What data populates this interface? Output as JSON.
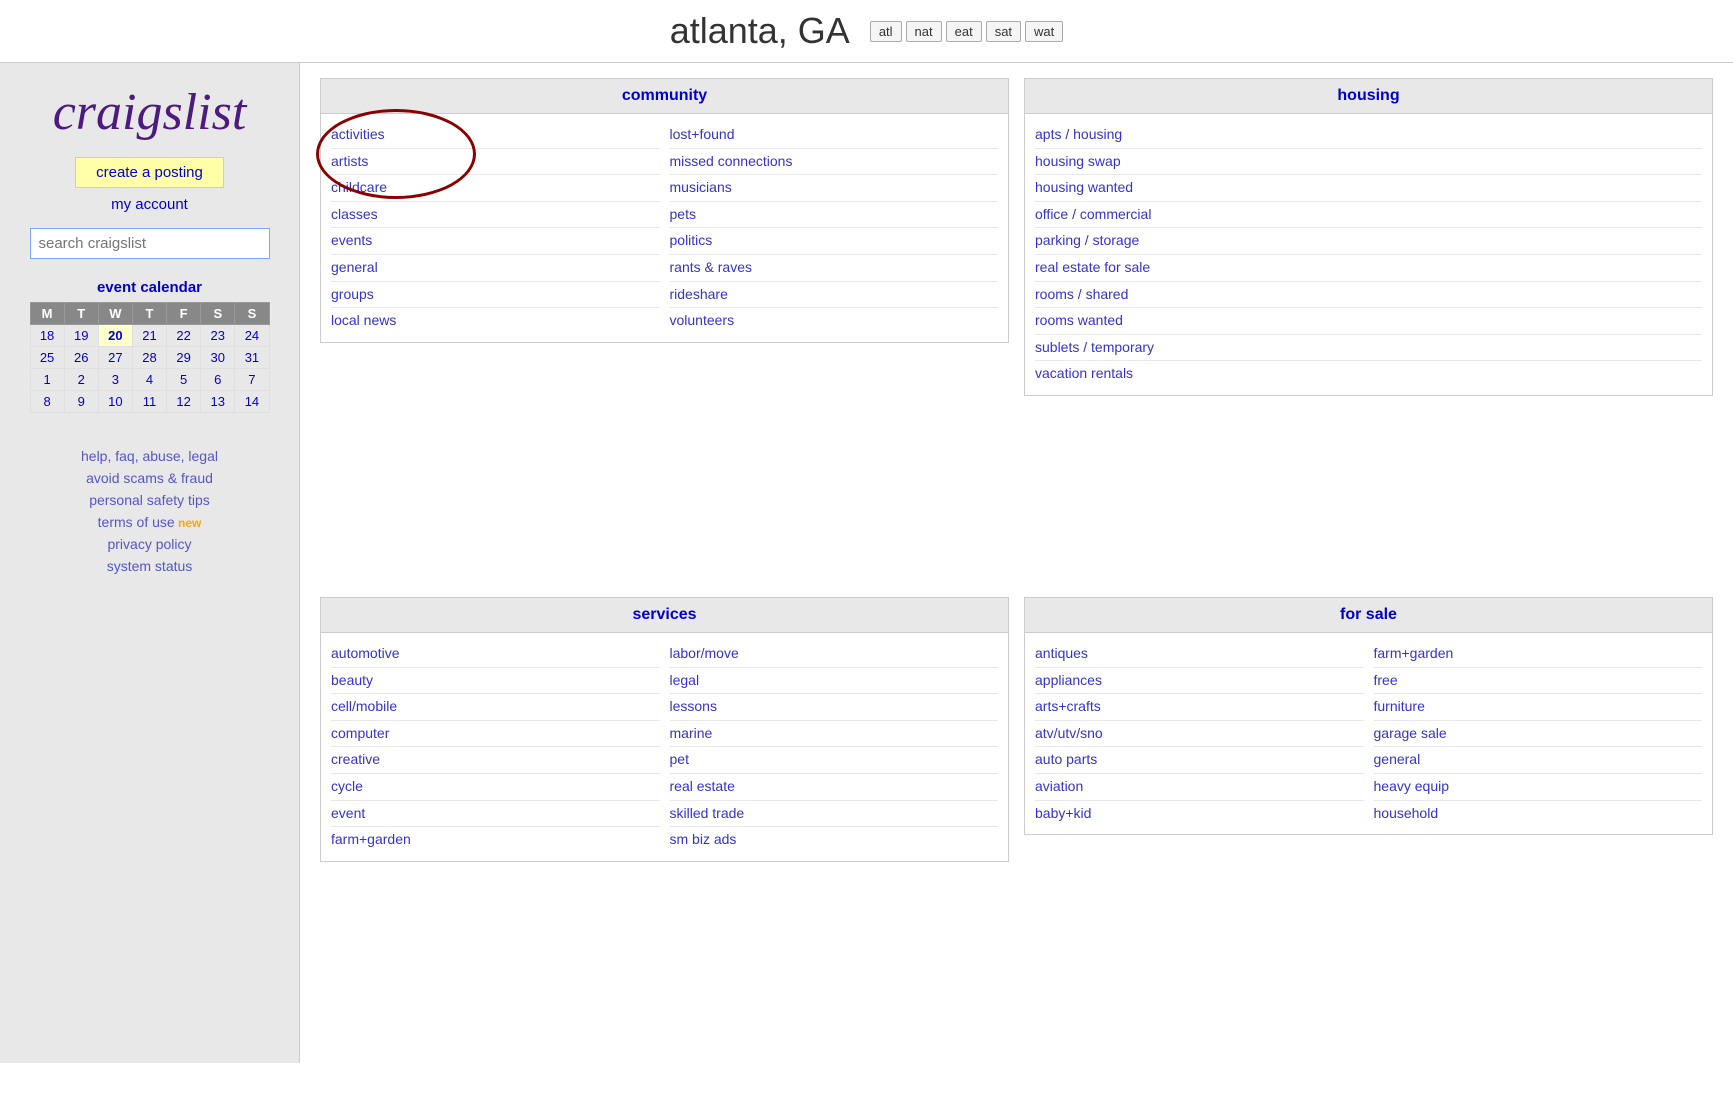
{
  "header": {
    "city": "atlanta, GA",
    "tabs": [
      "atl",
      "nat",
      "eat",
      "sat",
      "wat"
    ]
  },
  "sidebar": {
    "logo": "craigslist",
    "create_posting": "create a posting",
    "my_account": "my account",
    "search_placeholder": "search craigslist",
    "calendar_title": "event calendar",
    "calendar": {
      "days_header": [
        "M",
        "T",
        "W",
        "T",
        "F",
        "S",
        "S"
      ],
      "rows": [
        [
          "18",
          "19",
          "20",
          "21",
          "22",
          "23",
          "24"
        ],
        [
          "25",
          "26",
          "27",
          "28",
          "29",
          "30",
          "31"
        ],
        [
          "1",
          "2",
          "3",
          "4",
          "5",
          "6",
          "7"
        ],
        [
          "8",
          "9",
          "10",
          "11",
          "12",
          "13",
          "14"
        ]
      ],
      "today": "20"
    },
    "links": [
      {
        "label": "help, faq, abuse, legal",
        "new": false
      },
      {
        "label": "avoid scams & fraud",
        "new": false
      },
      {
        "label": "personal safety tips",
        "new": false
      },
      {
        "label": "terms of use",
        "new": true
      },
      {
        "label": "privacy policy",
        "new": false
      },
      {
        "label": "system status",
        "new": false
      }
    ]
  },
  "community": {
    "header": "community",
    "col1": [
      "activities",
      "artists",
      "childcare",
      "classes",
      "events",
      "general",
      "groups",
      "local news"
    ],
    "col2": [
      "lost+found",
      "missed connections",
      "musicians",
      "pets",
      "politics",
      "rants & raves",
      "rideshare",
      "volunteers"
    ]
  },
  "services": {
    "header": "services",
    "col1": [
      "automotive",
      "beauty",
      "cell/mobile",
      "computer",
      "creative",
      "cycle",
      "event",
      "farm+garden"
    ],
    "col2": [
      "labor/move",
      "legal",
      "lessons",
      "marine",
      "pet",
      "real estate",
      "skilled trade",
      "sm biz ads"
    ]
  },
  "housing": {
    "header": "housing",
    "col1": [
      "apts / housing",
      "housing swap",
      "housing wanted",
      "office / commercial",
      "parking / storage",
      "real estate for sale",
      "rooms / shared",
      "rooms wanted",
      "sublets / temporary",
      "vacation rentals"
    ]
  },
  "forsale": {
    "header": "for sale",
    "col1": [
      "antiques",
      "appliances",
      "arts+crafts",
      "atv/utv/sno",
      "auto parts",
      "aviation",
      "baby+kid"
    ],
    "col2": [
      "farm+garden",
      "free",
      "furniture",
      "garage sale",
      "general",
      "heavy equip",
      "household"
    ]
  }
}
